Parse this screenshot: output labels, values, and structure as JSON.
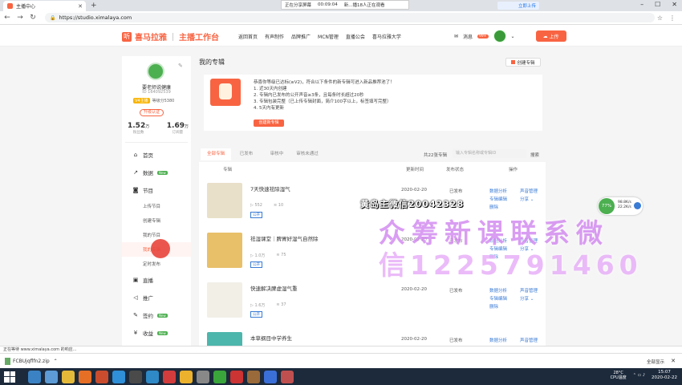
{
  "browser": {
    "tab_title": "主播中心",
    "url": "https://studio.ximalaya.com",
    "share_bar": [
      "正在分享屏幕",
      "00:09:04",
      "新...播18人正在观看"
    ],
    "update_label": "立即上传"
  },
  "header": {
    "logo_text": "喜马拉雅",
    "logo_sub": "主播工作台",
    "nav": [
      "返回首页",
      "有声制作",
      "品牌推广",
      "MCN管理",
      "直播公会",
      "喜马拉雅大学"
    ],
    "message_label": "消息",
    "message_badge": "99+",
    "upload_label": "上传"
  },
  "sidebar": {
    "name": "要老师说健康",
    "id": "ID 164092539",
    "level_badge": "V4主播",
    "level_text": "等级分5380",
    "certify_label": "升级认证",
    "stats": [
      {
        "value": "1.52",
        "unit": "万",
        "label": "粉丝数"
      },
      {
        "value": "1.69",
        "unit": "万",
        "label": "订阅量"
      }
    ],
    "menu": [
      {
        "icon": "home-icon",
        "glyph": "⌂",
        "label": "首页",
        "new": ""
      },
      {
        "icon": "chart-icon",
        "glyph": "↗",
        "label": "数据",
        "new": "New"
      },
      {
        "icon": "program-icon",
        "glyph": "◙",
        "label": "节目",
        "new": ""
      }
    ],
    "submenu": [
      "上传节目",
      "创建专辑",
      "我的节目",
      "我的专辑",
      "定时发布"
    ],
    "menu2": [
      {
        "icon": "live-icon",
        "glyph": "▣",
        "label": "直播",
        "new": ""
      },
      {
        "icon": "promote-icon",
        "glyph": "◁",
        "label": "推广",
        "new": ""
      },
      {
        "icon": "contract-icon",
        "glyph": "✎",
        "label": "签约",
        "new": "New"
      },
      {
        "icon": "income-icon",
        "glyph": "¥",
        "label": "收益",
        "new": "New"
      }
    ]
  },
  "main": {
    "title": "我的专辑",
    "create_label": "创建专辑",
    "notice_lines": [
      "恭喜你等级已达标(≥V2)，符合以下条件的新专辑可进入新品推荐池了！",
      "1. 近30天内创建",
      "2. 专辑内已发布的公开声音≥3条，且每条时长超过20秒",
      "3. 专辑包装完整（已上传专辑封面，简介100字以上，标签填写完整）",
      "4. 5天内有更新"
    ],
    "notice_button": "创建新专辑",
    "tabs": [
      "全部专辑",
      "已发布",
      "审核中",
      "审核未通过"
    ],
    "count_label": "共22张专辑",
    "search_placeholder": "输入专辑名称或专辑ID",
    "search_label": "搜索",
    "columns": [
      "专辑",
      "更新时间",
      "发布状态",
      "操作"
    ],
    "rows": [
      {
        "title": "7天快速祛除湿气",
        "plays": "552",
        "subs": "10",
        "public": "公开",
        "date": "2020-02-20",
        "status": "已发布",
        "ops": [
          "数据分析",
          "声音管理",
          "专辑编辑",
          "分享 ⌄",
          "删除"
        ]
      },
      {
        "title": "祛湿课堂｜脾胃好湿气自然除",
        "plays": "1.0万",
        "subs": "75",
        "public": "公开",
        "date": "2020-02-20",
        "status": "已发布",
        "ops": [
          "数据分析",
          "声音管理",
          "专辑编辑",
          "分享 ⌄",
          "删除"
        ]
      },
      {
        "title": "快速解决脾虚湿气重",
        "plays": "1.6万",
        "subs": "37",
        "public": "公开",
        "date": "2020-02-20",
        "status": "已发布",
        "ops": [
          "数据分析",
          "声音管理",
          "专辑编辑",
          "分享 ⌄",
          "删除"
        ]
      },
      {
        "title": "本草纲目中学养生",
        "plays": "",
        "subs": "",
        "public": "",
        "date": "2020-02-20",
        "status": "已发布",
        "ops": [
          "数据分析",
          "声音管理"
        ]
      }
    ]
  },
  "overlay": {
    "line1": "黄岛主微信20042328",
    "line2": "众筹新课联系微",
    "line3": "信1225791460"
  },
  "perf": {
    "percent": "77%",
    "up": "98.8K/s",
    "down": "22.2K/s"
  },
  "statusbar": {
    "text": "正在等待 www.ximalaya.com 的响应..."
  },
  "downloads": {
    "file": "FCBUjqflfn2.zip",
    "show_all": "全部显示"
  },
  "taskbar": {
    "temp": "28°C",
    "temp_label": "CPU温度",
    "time": "15:07",
    "date": "2020-02-22"
  },
  "colors": {
    "brand": "#f86442",
    "link": "#3a7bd5"
  }
}
